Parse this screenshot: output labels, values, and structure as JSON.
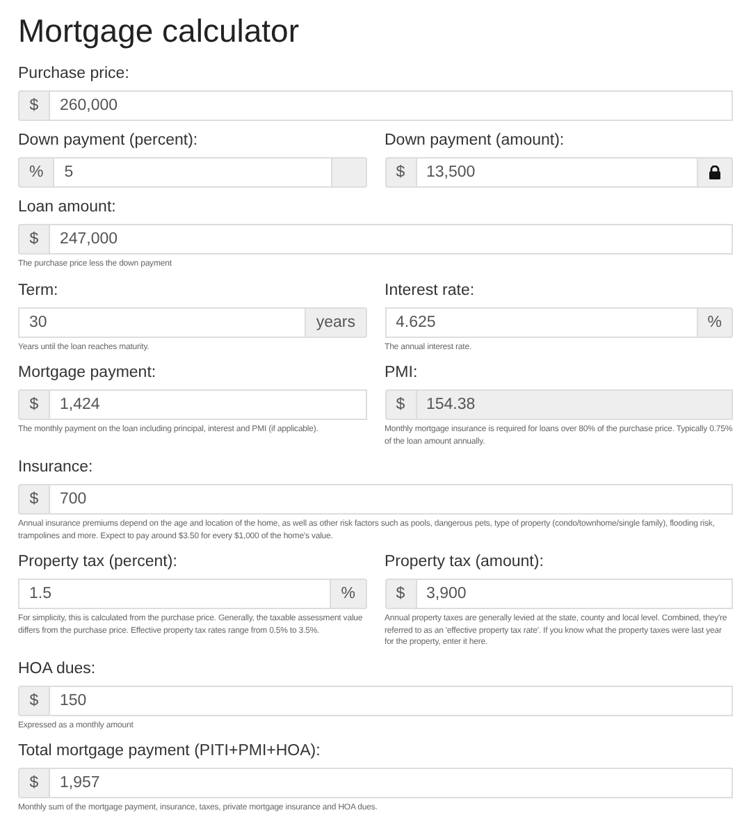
{
  "title": "Mortgage calculator",
  "rows": [
    {
      "fields": [
        {
          "label": "Purchase price:",
          "prefix": "$",
          "value": "260,000",
          "disabled": false
        }
      ]
    },
    {
      "fields": [
        {
          "label": "Down payment (percent):",
          "prefix": "%",
          "value": "5",
          "end_addon": {
            "kind": "blank"
          },
          "disabled": false
        },
        {
          "label": "Down payment (amount):",
          "prefix": "$",
          "value": "13,500",
          "end_addon": {
            "kind": "lock"
          },
          "disabled": false
        }
      ]
    },
    {
      "fields": [
        {
          "label": "Loan amount:",
          "prefix": "$",
          "value": "247,000",
          "help": "The purchase price less the down payment",
          "disabled": false
        }
      ]
    },
    {
      "fields": [
        {
          "label": "Term:",
          "value": "30",
          "end_addon": {
            "kind": "text",
            "text": "years"
          },
          "help": "Years until the loan reaches maturity.",
          "disabled": false
        },
        {
          "label": "Interest rate:",
          "value": "4.625",
          "end_addon": {
            "kind": "text",
            "text": "%"
          },
          "help": "The annual interest rate.",
          "disabled": false
        }
      ]
    },
    {
      "fields": [
        {
          "label": "Mortgage payment:",
          "prefix": "$",
          "value": "1,424",
          "help": "The monthly payment on the loan including principal, interest and PMI (if applicable).",
          "disabled": false
        },
        {
          "label": "PMI:",
          "prefix": "$",
          "value": "154.38",
          "help": "Monthly mortgage insurance is required for loans over 80% of the purchase price. Typically 0.75% of the loan amount annually.",
          "disabled": true
        }
      ]
    },
    {
      "fields": [
        {
          "label": "Insurance:",
          "prefix": "$",
          "value": "700",
          "help": "Annual insurance premiums depend on the age and location of the home, as well as other risk factors such as pools, dangerous pets, type of property (condo/townhome/single family), flooding risk, trampolines and more. Expect to pay around $3.50 for every $1,000 of the home's value.",
          "disabled": false
        }
      ]
    },
    {
      "fields": [
        {
          "label": "Property tax (percent):",
          "value": "1.5",
          "end_addon": {
            "kind": "text",
            "text": "%"
          },
          "help": "For simplicity, this is calculated from the purchase price. Generally, the taxable assessment value differs from the purchase price. Effective property tax rates range from 0.5% to 3.5%.",
          "disabled": false
        },
        {
          "label": "Property tax (amount):",
          "prefix": "$",
          "value": "3,900",
          "help": "Annual property taxes are generally levied at the state, county and local level. Combined, they're referred to as an 'effective property tax rate'. If you know what the property taxes were last year for the property, enter it here.",
          "disabled": false
        }
      ]
    },
    {
      "fields": [
        {
          "label": "HOA dues:",
          "prefix": "$",
          "value": "150",
          "help": "Expressed as a monthly amount",
          "disabled": false
        }
      ]
    },
    {
      "fields": [
        {
          "label": "Total mortgage payment (PITI+PMI+HOA):",
          "prefix": "$",
          "value": "1,957",
          "help": "Monthly sum of the mortgage payment, insurance, taxes, private mortgage insurance and HOA dues.",
          "disabled": false
        }
      ]
    }
  ]
}
